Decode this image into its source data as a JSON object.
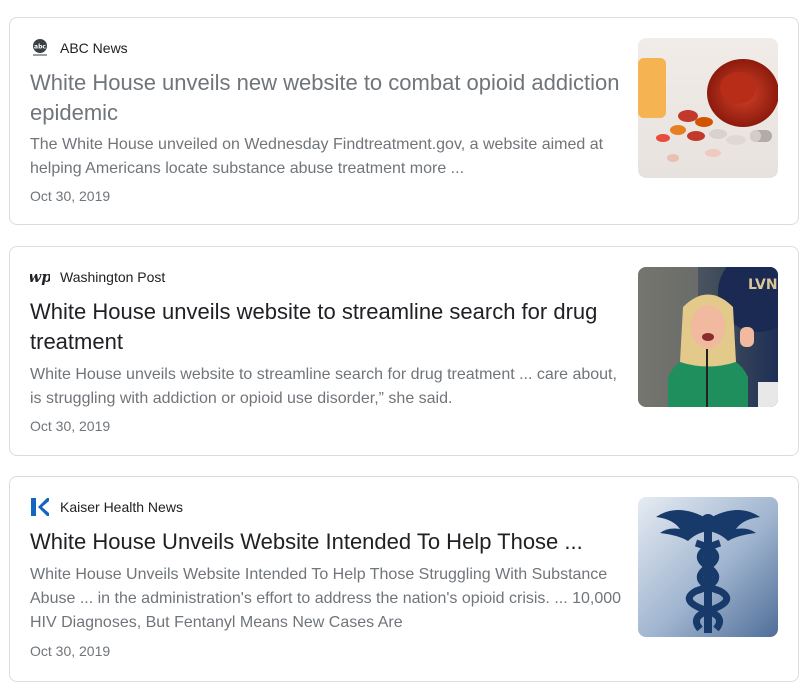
{
  "results": [
    {
      "source": "ABC News",
      "source_icon": "abc-news-logo-icon",
      "title": "White House unveils new website to combat opioid addiction epidemic",
      "snippet": "The White House unveiled on Wednesday Findtreatment.gov, a website aimed at helping Americans locate substance abuse treatment more ...",
      "date": "Oct 30, 2019",
      "thumbnail": "pills-photo"
    },
    {
      "source": "Washington Post",
      "source_icon": "washington-post-logo-icon",
      "title": "White House unveils website to streamline search for drug treatment",
      "snippet": "White House unveils website to streamline search for drug treatment ... care about, is struggling with addiction or opioid use disorder,” she said.",
      "date": "Oct 30, 2019",
      "thumbnail": "speaker-photo"
    },
    {
      "source": "Kaiser Health News",
      "source_icon": "kaiser-health-news-logo-icon",
      "title": "White House Unveils Website Intended To Help Those ...",
      "snippet": "White House Unveils Website Intended To Help Those Struggling With Substance Abuse ... in the administration's effort to address the nation's opioid crisis. ... 10,000 HIV Diagnoses, But Fentanyl Means New Cases Are",
      "date": "Oct 30, 2019",
      "thumbnail": "caduceus-photo"
    }
  ],
  "colors": {
    "border": "#dadce0",
    "title_visited": "#70757a",
    "title": "#202124",
    "snippet": "#70757a",
    "khn_blue": "#1565c0"
  }
}
